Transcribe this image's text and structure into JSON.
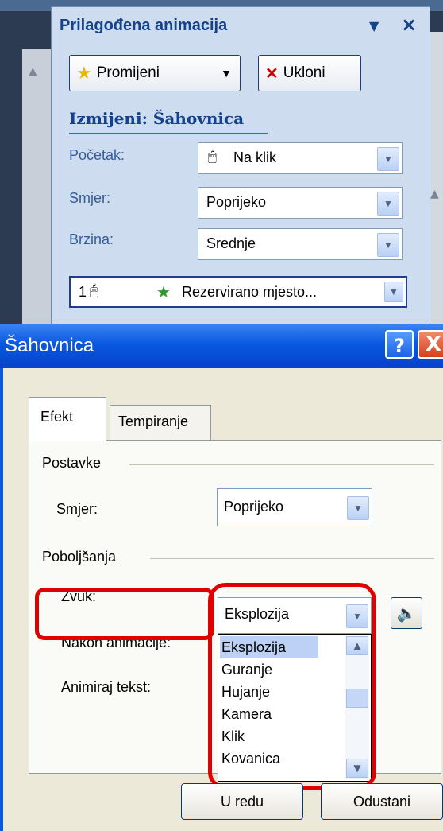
{
  "task_pane": {
    "title": "Prilagođena animacija",
    "change_button": "Promijeni",
    "remove_button": "Ukloni",
    "section_heading": "Izmijeni: Šahovnica",
    "start_label": "Početak:",
    "start_value": "Na klik",
    "direction_label": "Smjer:",
    "direction_value": "Poprijeko",
    "speed_label": "Brzina:",
    "speed_value": "Srednje",
    "list_item": {
      "index": "1",
      "text": "Rezervirano mjesto..."
    }
  },
  "dialog": {
    "title": "Šahovnica",
    "help_glyph": "?",
    "close_glyph": "X",
    "tabs": [
      "Efekt",
      "Tempiranje"
    ],
    "settings_group": "Postavke",
    "direction_label": "Smjer:",
    "direction_value": "Poprijeko",
    "enhancements_group": "Poboljšanja",
    "sound_label": "Zvuk:",
    "sound_value": "Eksplozija",
    "after_anim_label": "Nakon animacije:",
    "animate_text_label": "Animiraj tekst:",
    "sound_options": [
      "Eksplozija",
      "Guranje",
      "Hujanje",
      "Kamera",
      "Klik",
      "Kovanica"
    ],
    "ok_button": "U redu",
    "cancel_button": "Odustani"
  },
  "colors": {
    "highlight": "#e00000",
    "title_bar": "#0a58df"
  }
}
